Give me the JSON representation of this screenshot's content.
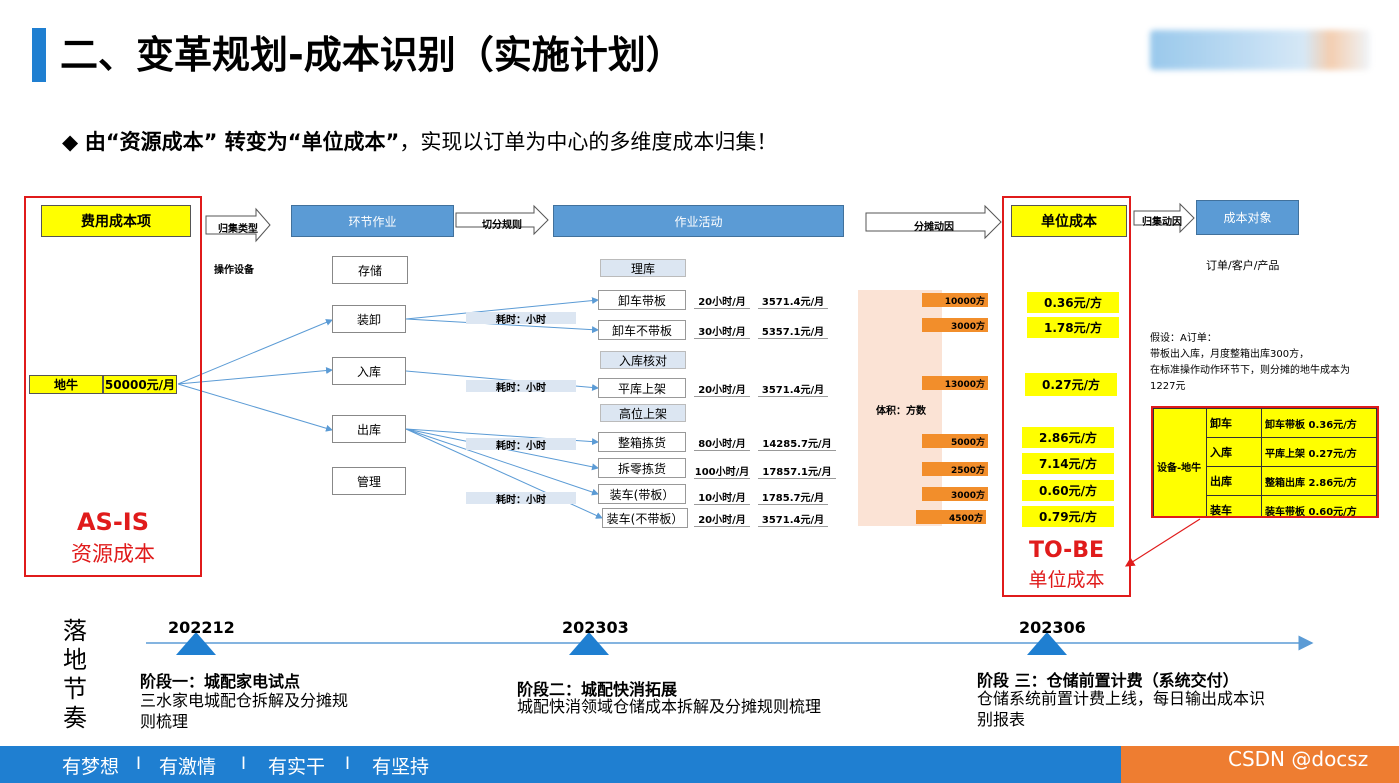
{
  "title": "二、变革规划-成本识别（实施计划）",
  "subtitle": {
    "bullet": "◆",
    "part1": "由“资源成本” 转变为“单位成本”",
    "part2": "，实现以订单为中心的多维度成本归集！"
  },
  "diagram": {
    "headers": {
      "cost_item": "费用成本项",
      "process": "环节作业",
      "activity": "作业活动",
      "unit_cost": "单位成本",
      "cost_object": "成本对象"
    },
    "arrow_labels": {
      "a1": "归集类型",
      "a2": "切分规则",
      "a3": "分摊动因",
      "a4": "归集动因"
    },
    "op_equipment": "操作设备",
    "resource": {
      "name": "地牛",
      "value": "50000元/月"
    },
    "processes": [
      "存储",
      "装卸",
      "入库",
      "出库",
      "管理"
    ],
    "activities": [
      "理库",
      "卸车带板",
      "卸车不带板",
      "入库核对",
      "平库上架",
      "高位上架",
      "整箱拣货",
      "拆零拣货",
      "装车(带板）",
      "装车(不带板）"
    ],
    "time_label": "耗时：小时",
    "hours": [
      {
        "hours": "20小时/月",
        "cost": "3571.4元/月"
      },
      {
        "hours": "30小时/月",
        "cost": "5357.1元/月"
      },
      {
        "hours": "20小时/月",
        "cost": "3571.4元/月"
      },
      {
        "hours": "80小时/月",
        "cost": "14285.7元/月"
      },
      {
        "hours": "100小时/月",
        "cost": "17857.1元/月"
      },
      {
        "hours": "10小时/月",
        "cost": "1785.7元/月"
      },
      {
        "hours": "20小时/月",
        "cost": "3571.4元/月"
      }
    ],
    "volume_label": "体积：方数",
    "volumes": [
      "10000方",
      "3000方",
      "13000方",
      "5000方",
      "2500方",
      "3000方",
      "4500方"
    ],
    "unit_costs": [
      "0.36元/方",
      "1.78元/方",
      "0.27元/方",
      "2.86元/方",
      "7.14元/方",
      "0.60元/方",
      "0.79元/方"
    ],
    "cost_object_value": "订单/客户/产品",
    "assumption": [
      "假设：A订单：",
      "带板出入库，月度整箱出库300方，",
      "在标准操作动作环节下，则分摊的地牛成本为",
      "1227元"
    ],
    "matrix": {
      "label": "设备-地牛",
      "rows": [
        {
          "process": "卸车",
          "detail": "卸车带板  0.36元/方"
        },
        {
          "process": "入库",
          "detail": "平库上架  0.27元/方"
        },
        {
          "process": "出库",
          "detail": "整箱出库  2.86元/方"
        },
        {
          "process": "装车",
          "detail": "装车带板  0.60元/方"
        }
      ]
    },
    "asis": {
      "title": "AS-IS",
      "subtitle": "资源成本"
    },
    "tobe": {
      "title": "TO-BE",
      "subtitle": "单位成本"
    }
  },
  "timeline": {
    "label": "落地节奏",
    "stages": [
      {
        "date": "202212",
        "title": "阶段一：城配家电试点",
        "desc": "三水家电城配仓拆解及分摊规则梳理"
      },
      {
        "date": "202303",
        "title": "阶段二：城配快消拓展",
        "desc": "城配快消领域仓储成本拆解及分摊规则梳理"
      },
      {
        "date": "202306",
        "title": "阶段 三：仓储前置计费（系统交付）",
        "desc": "仓储系统前置计费上线，每日输出成本识别报表"
      }
    ]
  },
  "footer": {
    "slogans": [
      "有梦想",
      "有激情",
      "有实干",
      "有坚持"
    ],
    "separator": "I",
    "watermark": "CSDN @docsz"
  },
  "colors": {
    "accent_blue": "#1f7fd1",
    "accent_orange": "#ee7d31",
    "red": "#e01b1b",
    "yellow": "#ffff00",
    "header_blue": "#5b9bd5"
  }
}
